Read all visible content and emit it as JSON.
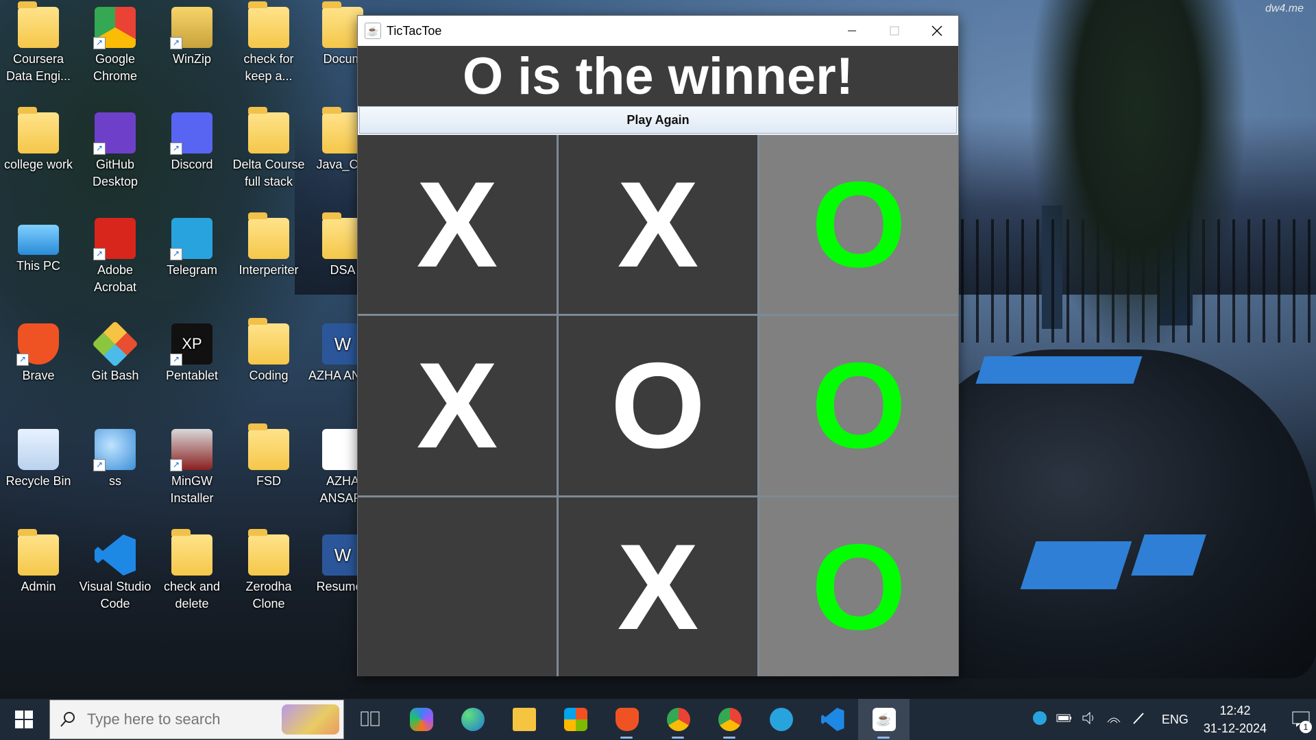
{
  "watermark": "dw4.me",
  "desktop_icons": [
    {
      "label": "Coursera Data Engi..."
    },
    {
      "label": "Google Chrome"
    },
    {
      "label": "WinZip"
    },
    {
      "label": "check for keep a..."
    },
    {
      "label": "Docum"
    },
    {
      "label": "college work"
    },
    {
      "label": "GitHub Desktop"
    },
    {
      "label": "Discord"
    },
    {
      "label": "Delta Course full stack"
    },
    {
      "label": "Java_Cor"
    },
    {
      "label": "This PC"
    },
    {
      "label": "Adobe Acrobat"
    },
    {
      "label": "Telegram"
    },
    {
      "label": "Interperiter"
    },
    {
      "label": "DSA"
    },
    {
      "label": "Brave"
    },
    {
      "label": "Git Bash"
    },
    {
      "label": "Pentablet"
    },
    {
      "label": "Coding"
    },
    {
      "label": "AZHA ANSA"
    },
    {
      "label": "Recycle Bin"
    },
    {
      "label": "ss"
    },
    {
      "label": "MinGW Installer"
    },
    {
      "label": "FSD"
    },
    {
      "label": "AZHA ANSARI"
    },
    {
      "label": "Admin"
    },
    {
      "label": "Visual Studio Code"
    },
    {
      "label": "check and delete"
    },
    {
      "label": "Zerodha Clone"
    },
    {
      "label": "Resume_"
    }
  ],
  "window": {
    "title": "TicTacToe",
    "status": "O is the winner!",
    "play_again_label": "Play Again",
    "board": [
      "X",
      "X",
      "O",
      "X",
      "O",
      "O",
      "",
      "X",
      "O"
    ],
    "winning_cells": [
      2,
      5,
      8
    ],
    "win_color": "#00ff00"
  },
  "taskbar": {
    "search_placeholder": "Type here to search",
    "language": "ENG",
    "time": "12:42",
    "date": "31-12-2024",
    "notification_count": "1"
  }
}
